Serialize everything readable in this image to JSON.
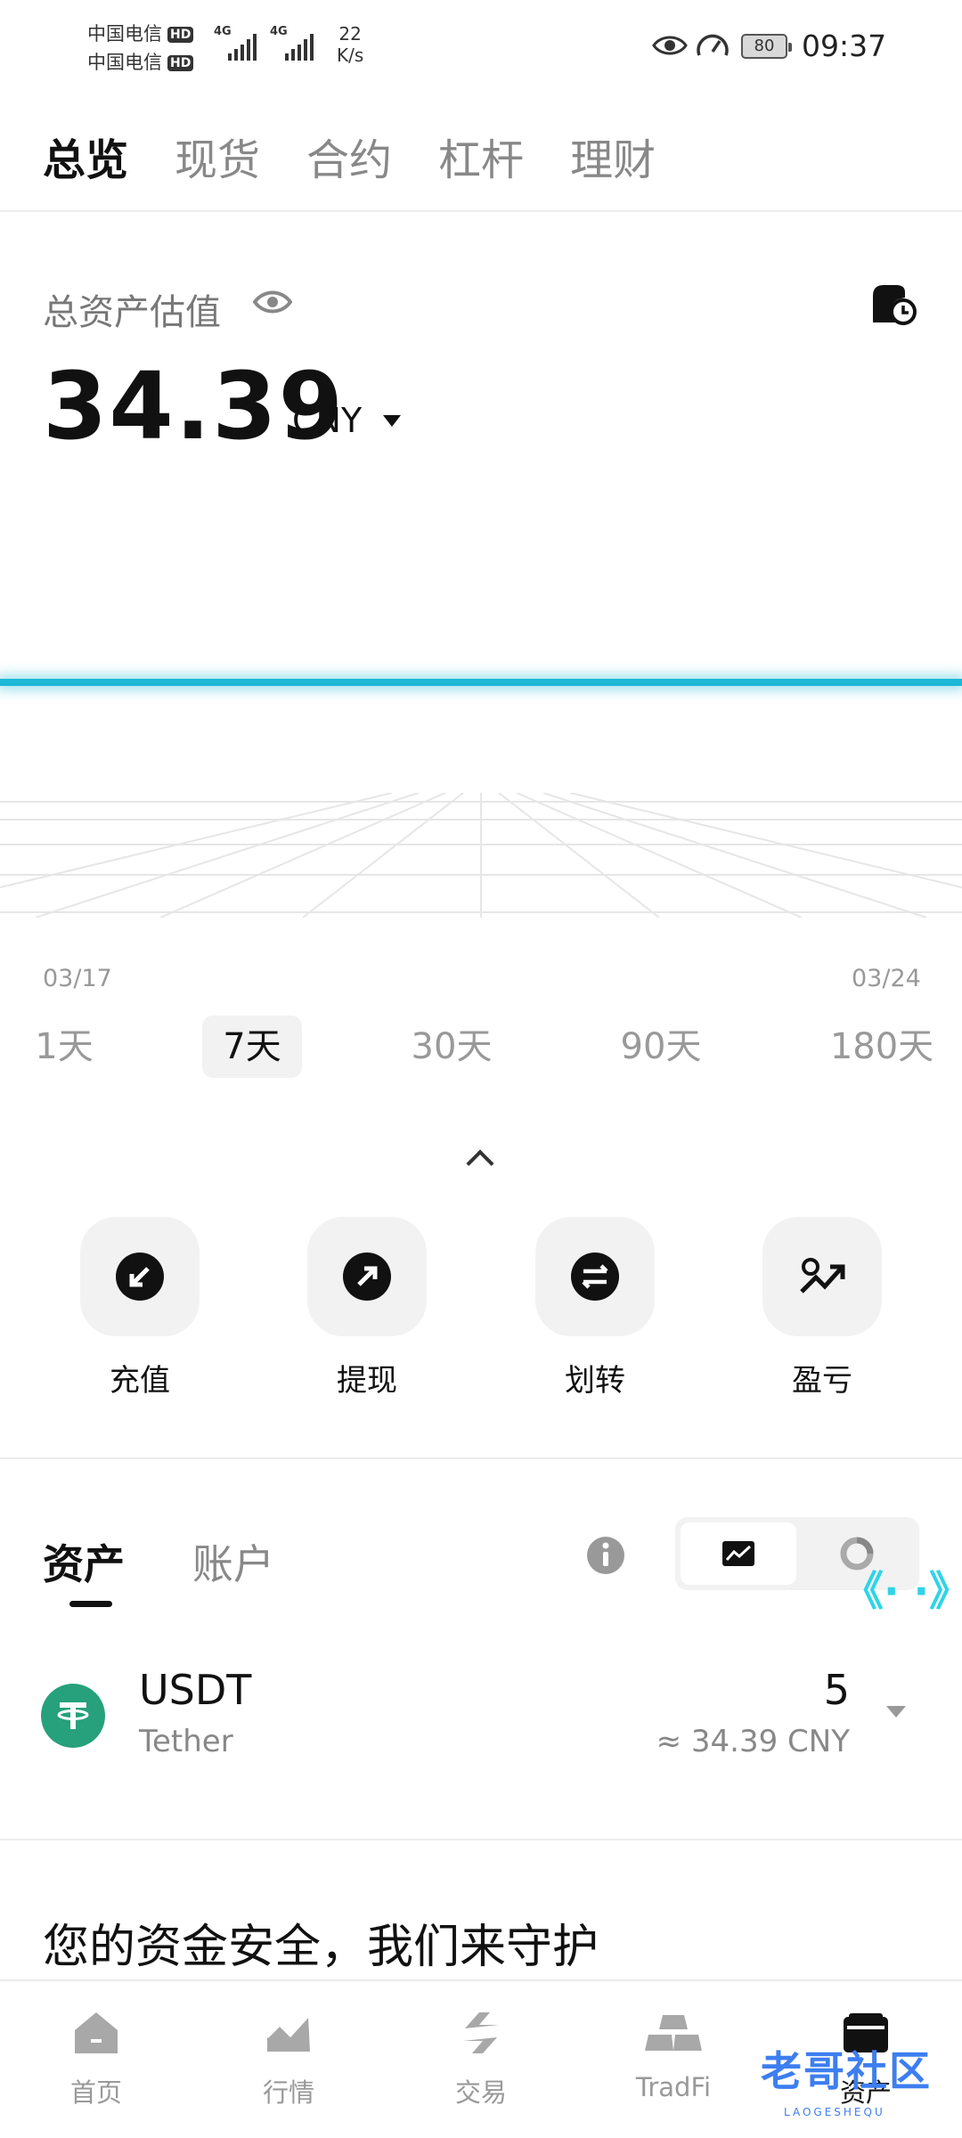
{
  "status_bar": {
    "carrier_1": "中国电信",
    "carrier_2": "中国电信",
    "hd_label": "HD",
    "network_1": "4G",
    "network_2": "4G",
    "net_speed_value": "22",
    "net_speed_unit": "K/s",
    "battery": "80",
    "time": "09:37"
  },
  "top_tabs": [
    "总览",
    "现货",
    "合约",
    "杠杆",
    "理财"
  ],
  "asset": {
    "label": "总资产估值",
    "amount": "34.39",
    "currency": "CNY"
  },
  "chart": {
    "start_date": "03/17",
    "end_date": "03/24",
    "ranges": [
      "1天",
      "7天",
      "30天",
      "90天",
      "180天"
    ],
    "selected_range": "7天",
    "line_color": "#1cb8d6"
  },
  "actions": [
    "充值",
    "提现",
    "划转",
    "盈亏"
  ],
  "section_tabs": {
    "assets": "资产",
    "accounts": "账户"
  },
  "holdings": [
    {
      "symbol": "USDT",
      "name": "Tether",
      "quantity": "5",
      "value": "≈ 34.39 CNY",
      "icon_color": "#26a17b"
    }
  ],
  "security_banner": "您的资金安全，我们来守护",
  "bottom_nav": [
    "首页",
    "行情",
    "交易",
    "TradFi",
    "资产"
  ],
  "floating_widget": "《· ·》",
  "watermark": {
    "text": "老哥社区",
    "sub": "LAOGESHEQU"
  }
}
